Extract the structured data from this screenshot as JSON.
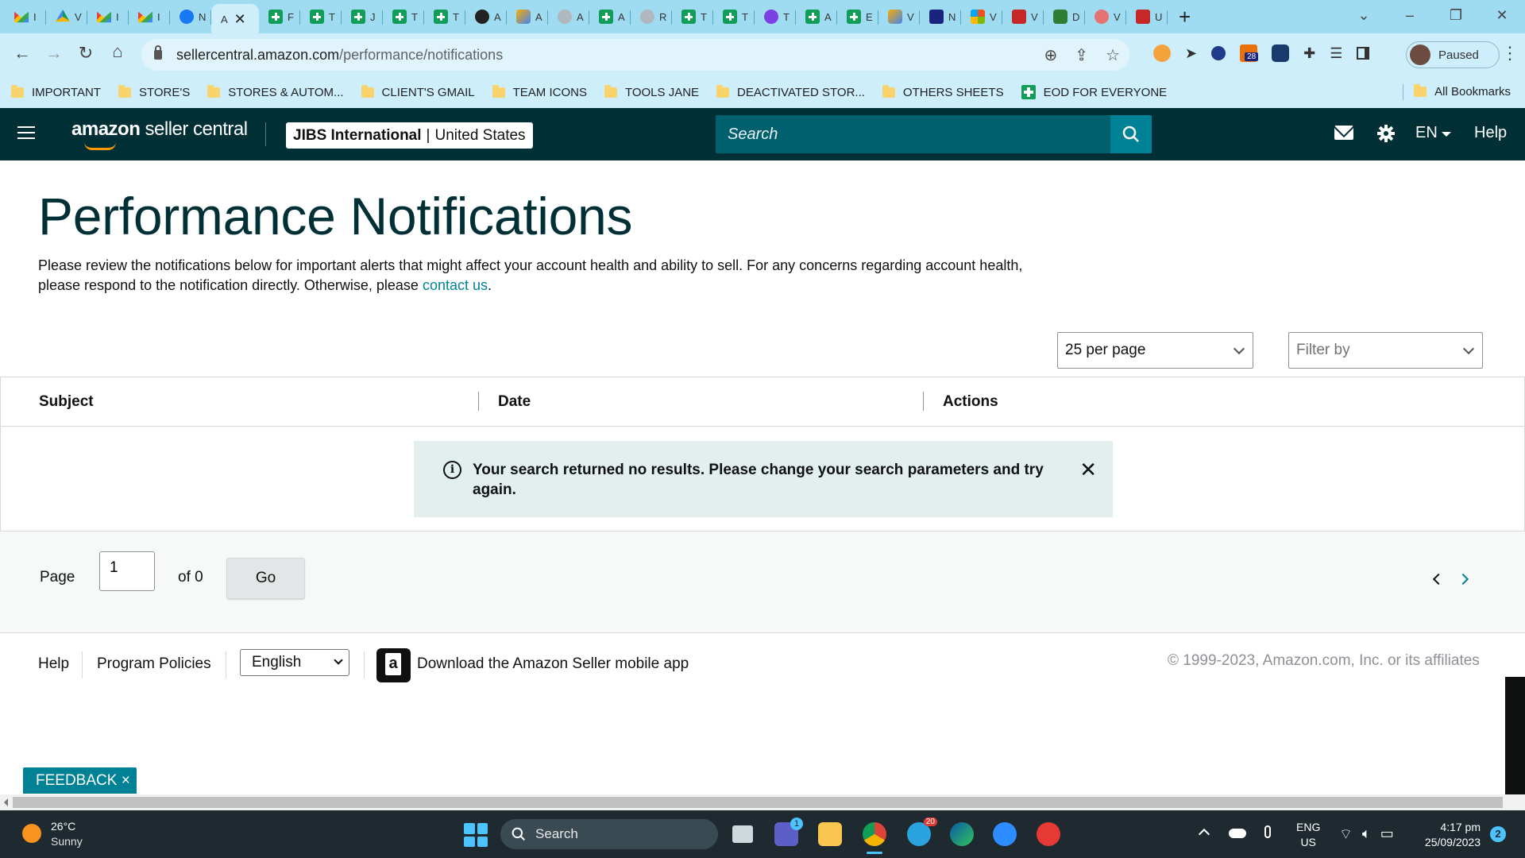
{
  "browser": {
    "tabs": [
      {
        "icon": "gmail-icon",
        "letter": "I"
      },
      {
        "icon": "drive-icon",
        "letter": "V"
      },
      {
        "icon": "gmail-icon",
        "letter": "I"
      },
      {
        "icon": "gmail-icon",
        "letter": "I"
      },
      {
        "icon": "facebook-icon",
        "letter": "N"
      },
      {
        "icon": "amazon-icon",
        "letter": "A",
        "active": true
      },
      {
        "icon": "sheets-icon",
        "letter": "F"
      },
      {
        "icon": "sheets-icon",
        "letter": "T"
      },
      {
        "icon": "sheets-icon",
        "letter": "J"
      },
      {
        "icon": "sheets-icon",
        "letter": "T"
      },
      {
        "icon": "sheets-icon",
        "letter": "T"
      },
      {
        "icon": "openai-icon",
        "letter": "A"
      },
      {
        "icon": "pencil-icon",
        "letter": "A"
      },
      {
        "icon": "grey-circle-icon",
        "letter": "A"
      },
      {
        "icon": "sheets-icon",
        "letter": "A"
      },
      {
        "icon": "chart-icon",
        "letter": "R"
      },
      {
        "icon": "sheets-icon",
        "letter": "T"
      },
      {
        "icon": "sheets-icon",
        "letter": "T"
      },
      {
        "icon": "chat-icon",
        "letter": "T"
      },
      {
        "icon": "sheets-icon",
        "letter": "A"
      },
      {
        "icon": "sheets-icon",
        "letter": "E"
      },
      {
        "icon": "pencil-icon",
        "letter": "V"
      },
      {
        "icon": "navy-icon",
        "letter": "N"
      },
      {
        "icon": "microsoft-icon",
        "letter": "V"
      },
      {
        "icon": "w-red-icon",
        "letter": "V"
      },
      {
        "icon": "w-green-icon",
        "letter": "D"
      },
      {
        "icon": "shop-icon",
        "letter": "V"
      },
      {
        "icon": "vpn-icon",
        "letter": "U"
      }
    ],
    "url_host": "sellercentral.amazon.com",
    "url_path": "/performance/notifications",
    "profile_label": "Paused",
    "extension_badge": "28",
    "bookmarks": [
      "IMPORTANT",
      "STORE'S",
      "STORES & AUTOM...",
      "CLIENT'S GMAIL",
      "TEAM ICONS",
      "TOOLS JANE",
      "DEACTIVATED STOR...",
      "OTHERS SHEETS"
    ],
    "bookmark_sheet": "EOD FOR EVERYONE",
    "all_bookmarks": "All Bookmarks"
  },
  "header": {
    "logo_bold": "amazon",
    "logo_rest": " seller central",
    "store_name": "JIBS International",
    "store_separator": "|",
    "store_region": "United States",
    "search_placeholder": "Search",
    "language": "EN",
    "help": "Help"
  },
  "main": {
    "title": "Performance Notifications",
    "description": "Please review the notifications below for important alerts that might affect your account health and ability to sell. For any concerns regarding account health, please respond to the notification directly. Otherwise, please ",
    "contact_link": "contact us",
    "description_end": ".",
    "per_page": "25 per page",
    "filter_placeholder": "Filter by",
    "columns": [
      "Subject",
      "Date",
      "Actions"
    ],
    "alert_message": "Your search returned no results. Please change your search parameters and try again.",
    "pager": {
      "page_label": "Page",
      "page_value": "1",
      "of_label": "of 0",
      "go_label": "Go"
    }
  },
  "footer": {
    "help": "Help",
    "policies": "Program Policies",
    "language": "English",
    "app_text": "Download the Amazon Seller mobile app",
    "copyright": "© 1999-2023, Amazon.com, Inc. or its affiliates",
    "feedback": "FEEDBACK ×"
  },
  "taskbar": {
    "temperature": "26°C",
    "condition": "Sunny",
    "search": "Search",
    "lang_line1": "ENG",
    "lang_line2": "US",
    "time": "4:17 pm",
    "date": "25/09/2023",
    "notifications": "2",
    "teams_badge": "1",
    "telegram_badge": "20"
  },
  "colors": {
    "header_bg": "#002f36",
    "accent": "#008296",
    "title": "#002f36",
    "alert_bg": "#e3efef",
    "chrome_bg": "#cdeefa"
  }
}
